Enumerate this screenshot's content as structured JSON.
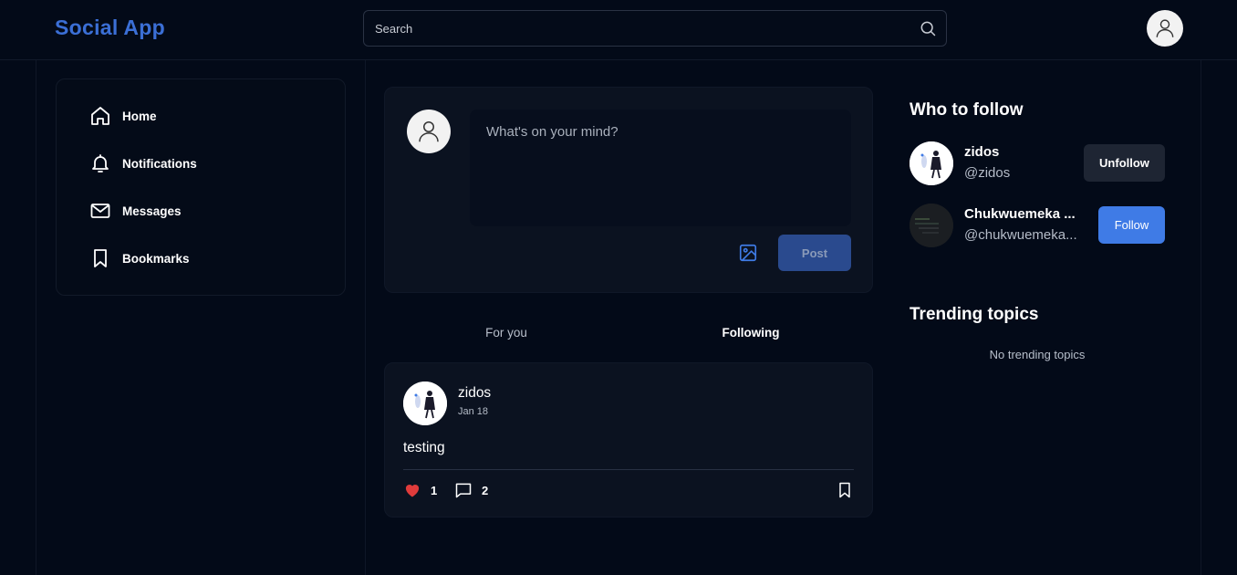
{
  "header": {
    "logo": "Social App",
    "search": {
      "placeholder": "Search"
    }
  },
  "sidebar": {
    "items": [
      {
        "label": "Home",
        "icon": "home-icon"
      },
      {
        "label": "Notifications",
        "icon": "bell-icon"
      },
      {
        "label": "Messages",
        "icon": "mail-icon"
      },
      {
        "label": "Bookmarks",
        "icon": "bookmark-icon"
      }
    ]
  },
  "composer": {
    "placeholder": "What's on your mind?",
    "post_label": "Post"
  },
  "feed_tabs": [
    {
      "label": "For you",
      "active": false
    },
    {
      "label": "Following",
      "active": true
    }
  ],
  "posts": [
    {
      "author": "zidos",
      "date": "Jan 18",
      "body": "testing",
      "likes": "1",
      "comments": "2",
      "liked": true
    }
  ],
  "who_to_follow": {
    "title": "Who to follow",
    "users": [
      {
        "name": "zidos",
        "handle": "@zidos",
        "action": "Unfollow"
      },
      {
        "name": "Chukwuemeka ...",
        "handle": "@chukwuemeka...",
        "action": "Follow"
      }
    ]
  },
  "trending": {
    "title": "Trending topics",
    "empty_text": "No trending topics"
  },
  "colors": {
    "background": "#030a18",
    "card": "#0b1220",
    "accent": "#3f7be6",
    "logo": "#3b6fd6",
    "like": "#e03b3b"
  }
}
